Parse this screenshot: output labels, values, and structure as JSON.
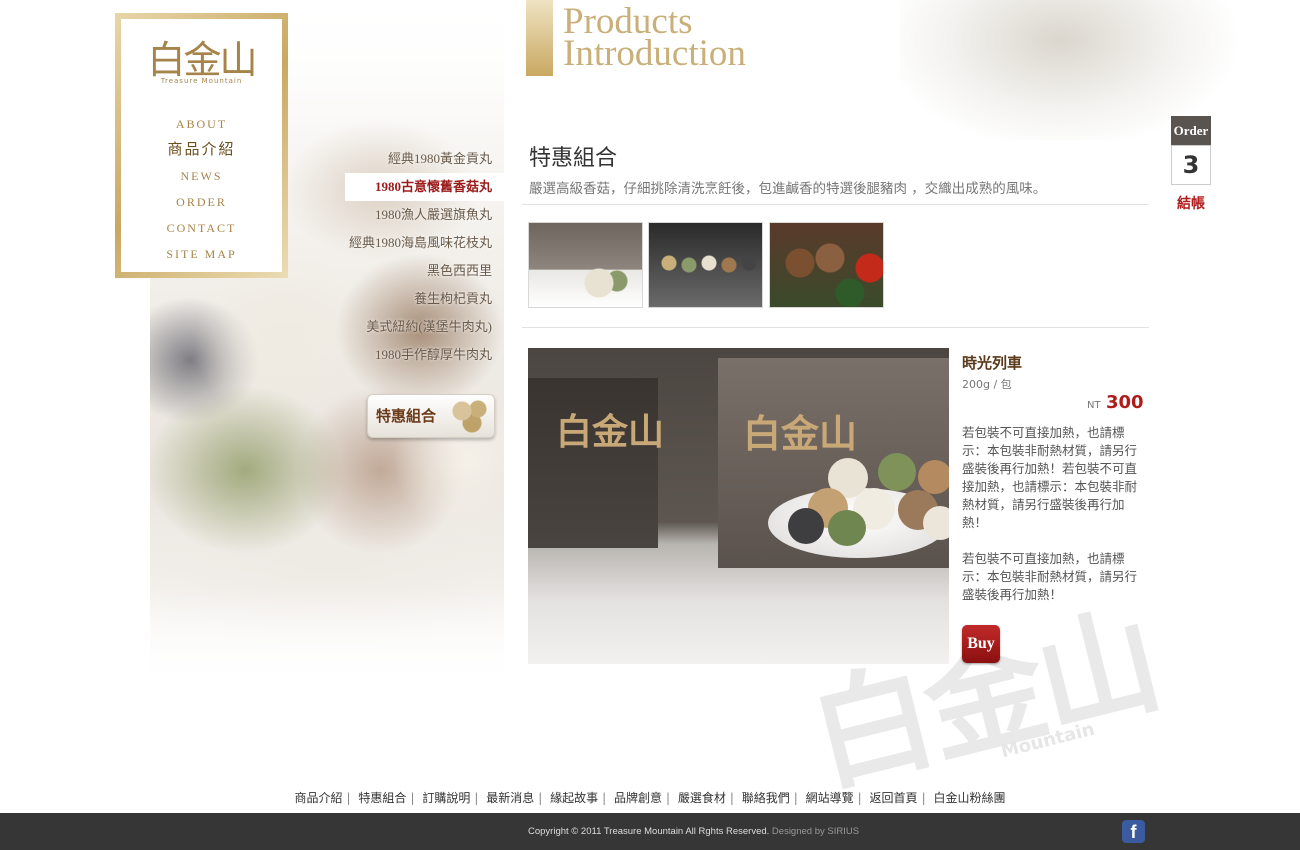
{
  "brand": {
    "logo_text": "白金山",
    "logo_sub": "Treasure   Mountain"
  },
  "main_nav": [
    {
      "label": "ABOUT"
    },
    {
      "label": "商品介紹"
    },
    {
      "label": "NEWS"
    },
    {
      "label": "ORDER"
    },
    {
      "label": "CONTACT"
    },
    {
      "label": "SITE MAP"
    }
  ],
  "sub_nav": [
    {
      "label": "經典1980黃金貢丸"
    },
    {
      "label": "1980古意懷舊香菇丸"
    },
    {
      "label": "1980漁人嚴選旗魚丸"
    },
    {
      "label": "經典1980海島風味花枝丸"
    },
    {
      "label": "黑色西西里"
    },
    {
      "label": "養生枸杞貢丸"
    },
    {
      "label": "美式紐約(漢堡牛肉丸)"
    },
    {
      "label": "1980手作醇厚牛肉丸"
    }
  ],
  "promo_button": "特惠組合",
  "header": {
    "line1": "Products",
    "line2": "Introduction"
  },
  "order": {
    "label": "Order",
    "count": "3",
    "checkout": "結帳"
  },
  "section": {
    "title": "特惠組合",
    "description": "嚴選高級香菇，仔細挑除清洗烹飪後，包進鹹香的特選後腿豬肉 ，交織出成熟的風味。"
  },
  "product": {
    "name": "時光列車",
    "weight": "200g / 包",
    "currency": "NT",
    "price": "300",
    "desc1": "若包裝不可直接加熱，也請標示：本包裝非耐熱材質，請另行盛裝後再行加熱！若包裝不可直接加熱，也請標示：本包裝非耐熱材質，請另行盛裝後再行加熱！",
    "desc2": "若包裝不可直接加熱，也請標示：本包裝非耐熱材質，請另行盛裝後再行加熱！",
    "buy_label": "Buy"
  },
  "footer": {
    "links": [
      {
        "label": "商品介紹"
      },
      {
        "label": "特惠組合"
      },
      {
        "label": "訂購說明"
      },
      {
        "label": "最新消息"
      },
      {
        "label": "緣起故事"
      },
      {
        "label": "品牌創意"
      },
      {
        "label": "嚴選食材"
      },
      {
        "label": "聯絡我們"
      },
      {
        "label": "網站導覽"
      },
      {
        "label": "返回首頁"
      },
      {
        "label": "白金山粉絲團"
      }
    ],
    "copyright": "Copyright © 2011 Treasure Mountain All Rghts Reserved.",
    "designed_by": "Designed by SIRIUS",
    "facebook_glyph": "f"
  },
  "watermark": {
    "text": "白金山",
    "sub": "Mountain"
  },
  "colors": {
    "gold": "#c9a862",
    "accent_red": "#b01c1c",
    "footer_bg": "#363636"
  },
  "icons": {
    "facebook": "facebook-icon",
    "logo": "treasure-mountain-logo"
  }
}
